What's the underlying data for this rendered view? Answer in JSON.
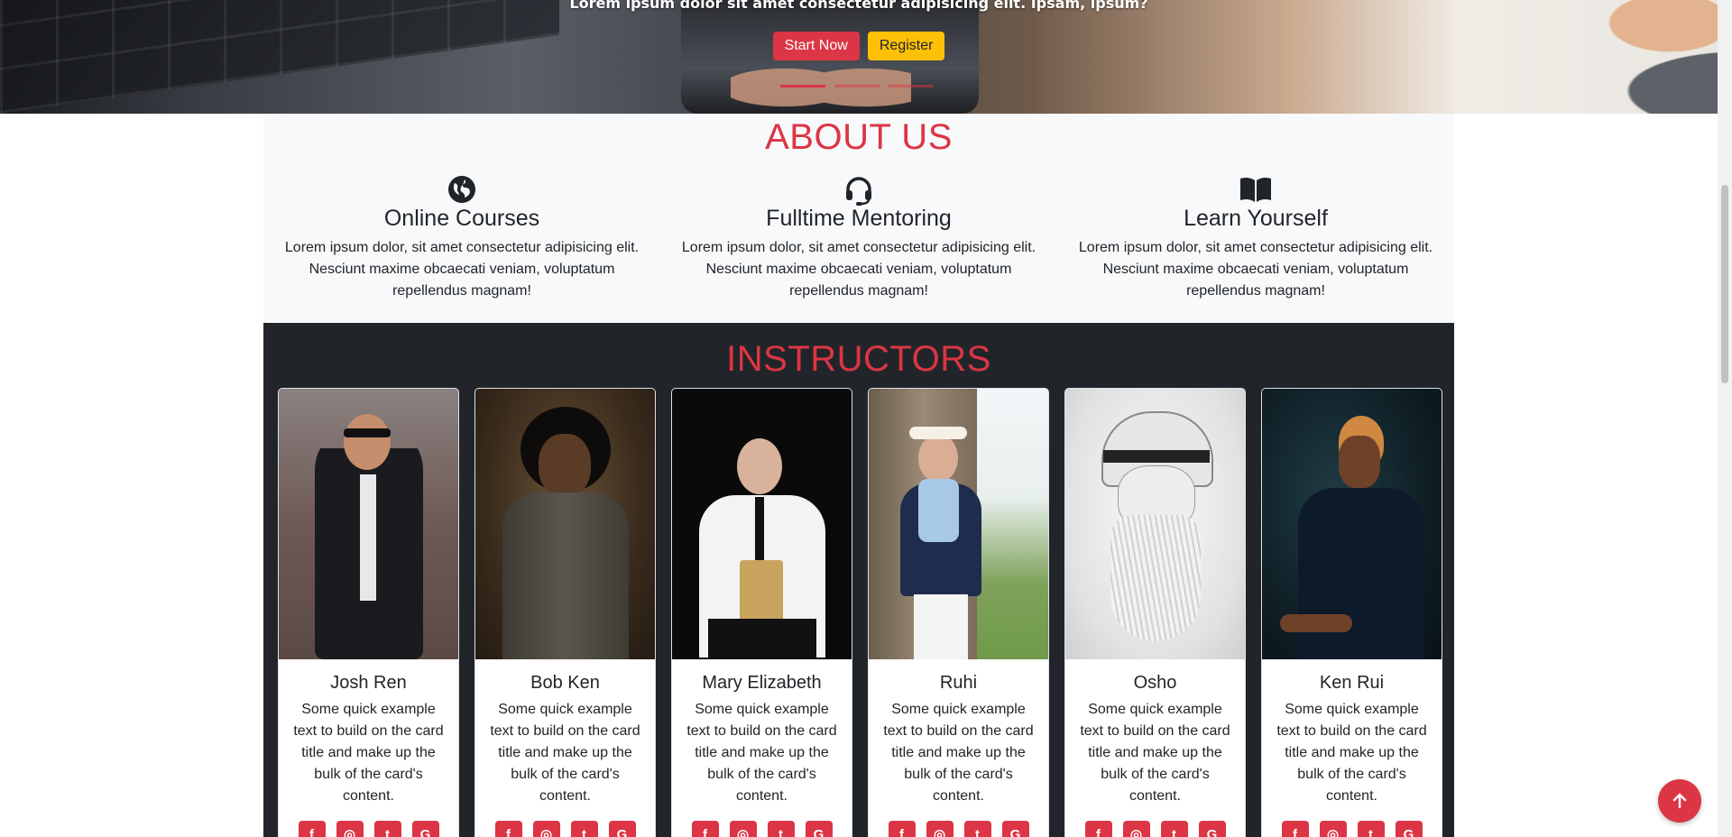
{
  "hero": {
    "tagline": "Lorem ipsum dolor sit amet consectetur adipisicing elit. Ipsam, ipsum?",
    "start_label": "Start Now",
    "register_label": "Register"
  },
  "about": {
    "title": "ABOUT US",
    "features": [
      {
        "icon": "globe-icon",
        "title": "Online Courses",
        "text": "Lorem ipsum dolor, sit amet consectetur adipisicing elit. Nesciunt maxime obcaecati veniam, voluptatum repellendus magnam!"
      },
      {
        "icon": "headset-icon",
        "title": "Fulltime Mentoring",
        "text": "Lorem ipsum dolor, sit amet consectetur adipisicing elit. Nesciunt maxime obcaecati veniam, voluptatum repellendus magnam!"
      },
      {
        "icon": "book-icon",
        "title": "Learn Yourself",
        "text": "Lorem ipsum dolor, sit amet consectetur adipisicing elit. Nesciunt maxime obcaecati veniam, voluptatum repellendus magnam!"
      }
    ]
  },
  "instructors": {
    "title": "INSTRUCTORS",
    "cards": [
      {
        "name": "Josh Ren",
        "text": "Some quick example text to build on the card title and make up the bulk of the card's content."
      },
      {
        "name": "Bob Ken",
        "text": "Some quick example text to build on the card title and make up the bulk of the card's content."
      },
      {
        "name": "Mary Elizabeth",
        "text": "Some quick example text to build on the card title and make up the bulk of the card's content."
      },
      {
        "name": "Ruhi",
        "text": "Some quick example text to build on the card title and make up the bulk of the card's content."
      },
      {
        "name": "Osho",
        "text": "Some quick example text to build on the card title and make up the bulk of the card's content."
      },
      {
        "name": "Ken Rui",
        "text": "Some quick example text to build on the card title and make up the bulk of the card's content."
      }
    ],
    "social_icons": [
      "facebook-icon",
      "instagram-icon",
      "twitter-icon",
      "google-icon"
    ]
  },
  "colors": {
    "accent": "#dc3545",
    "warning": "#ffc107",
    "dark": "#212529",
    "light": "#f8f9fa"
  },
  "ui": {
    "back_to_top_icon": "arrow-up-icon"
  }
}
